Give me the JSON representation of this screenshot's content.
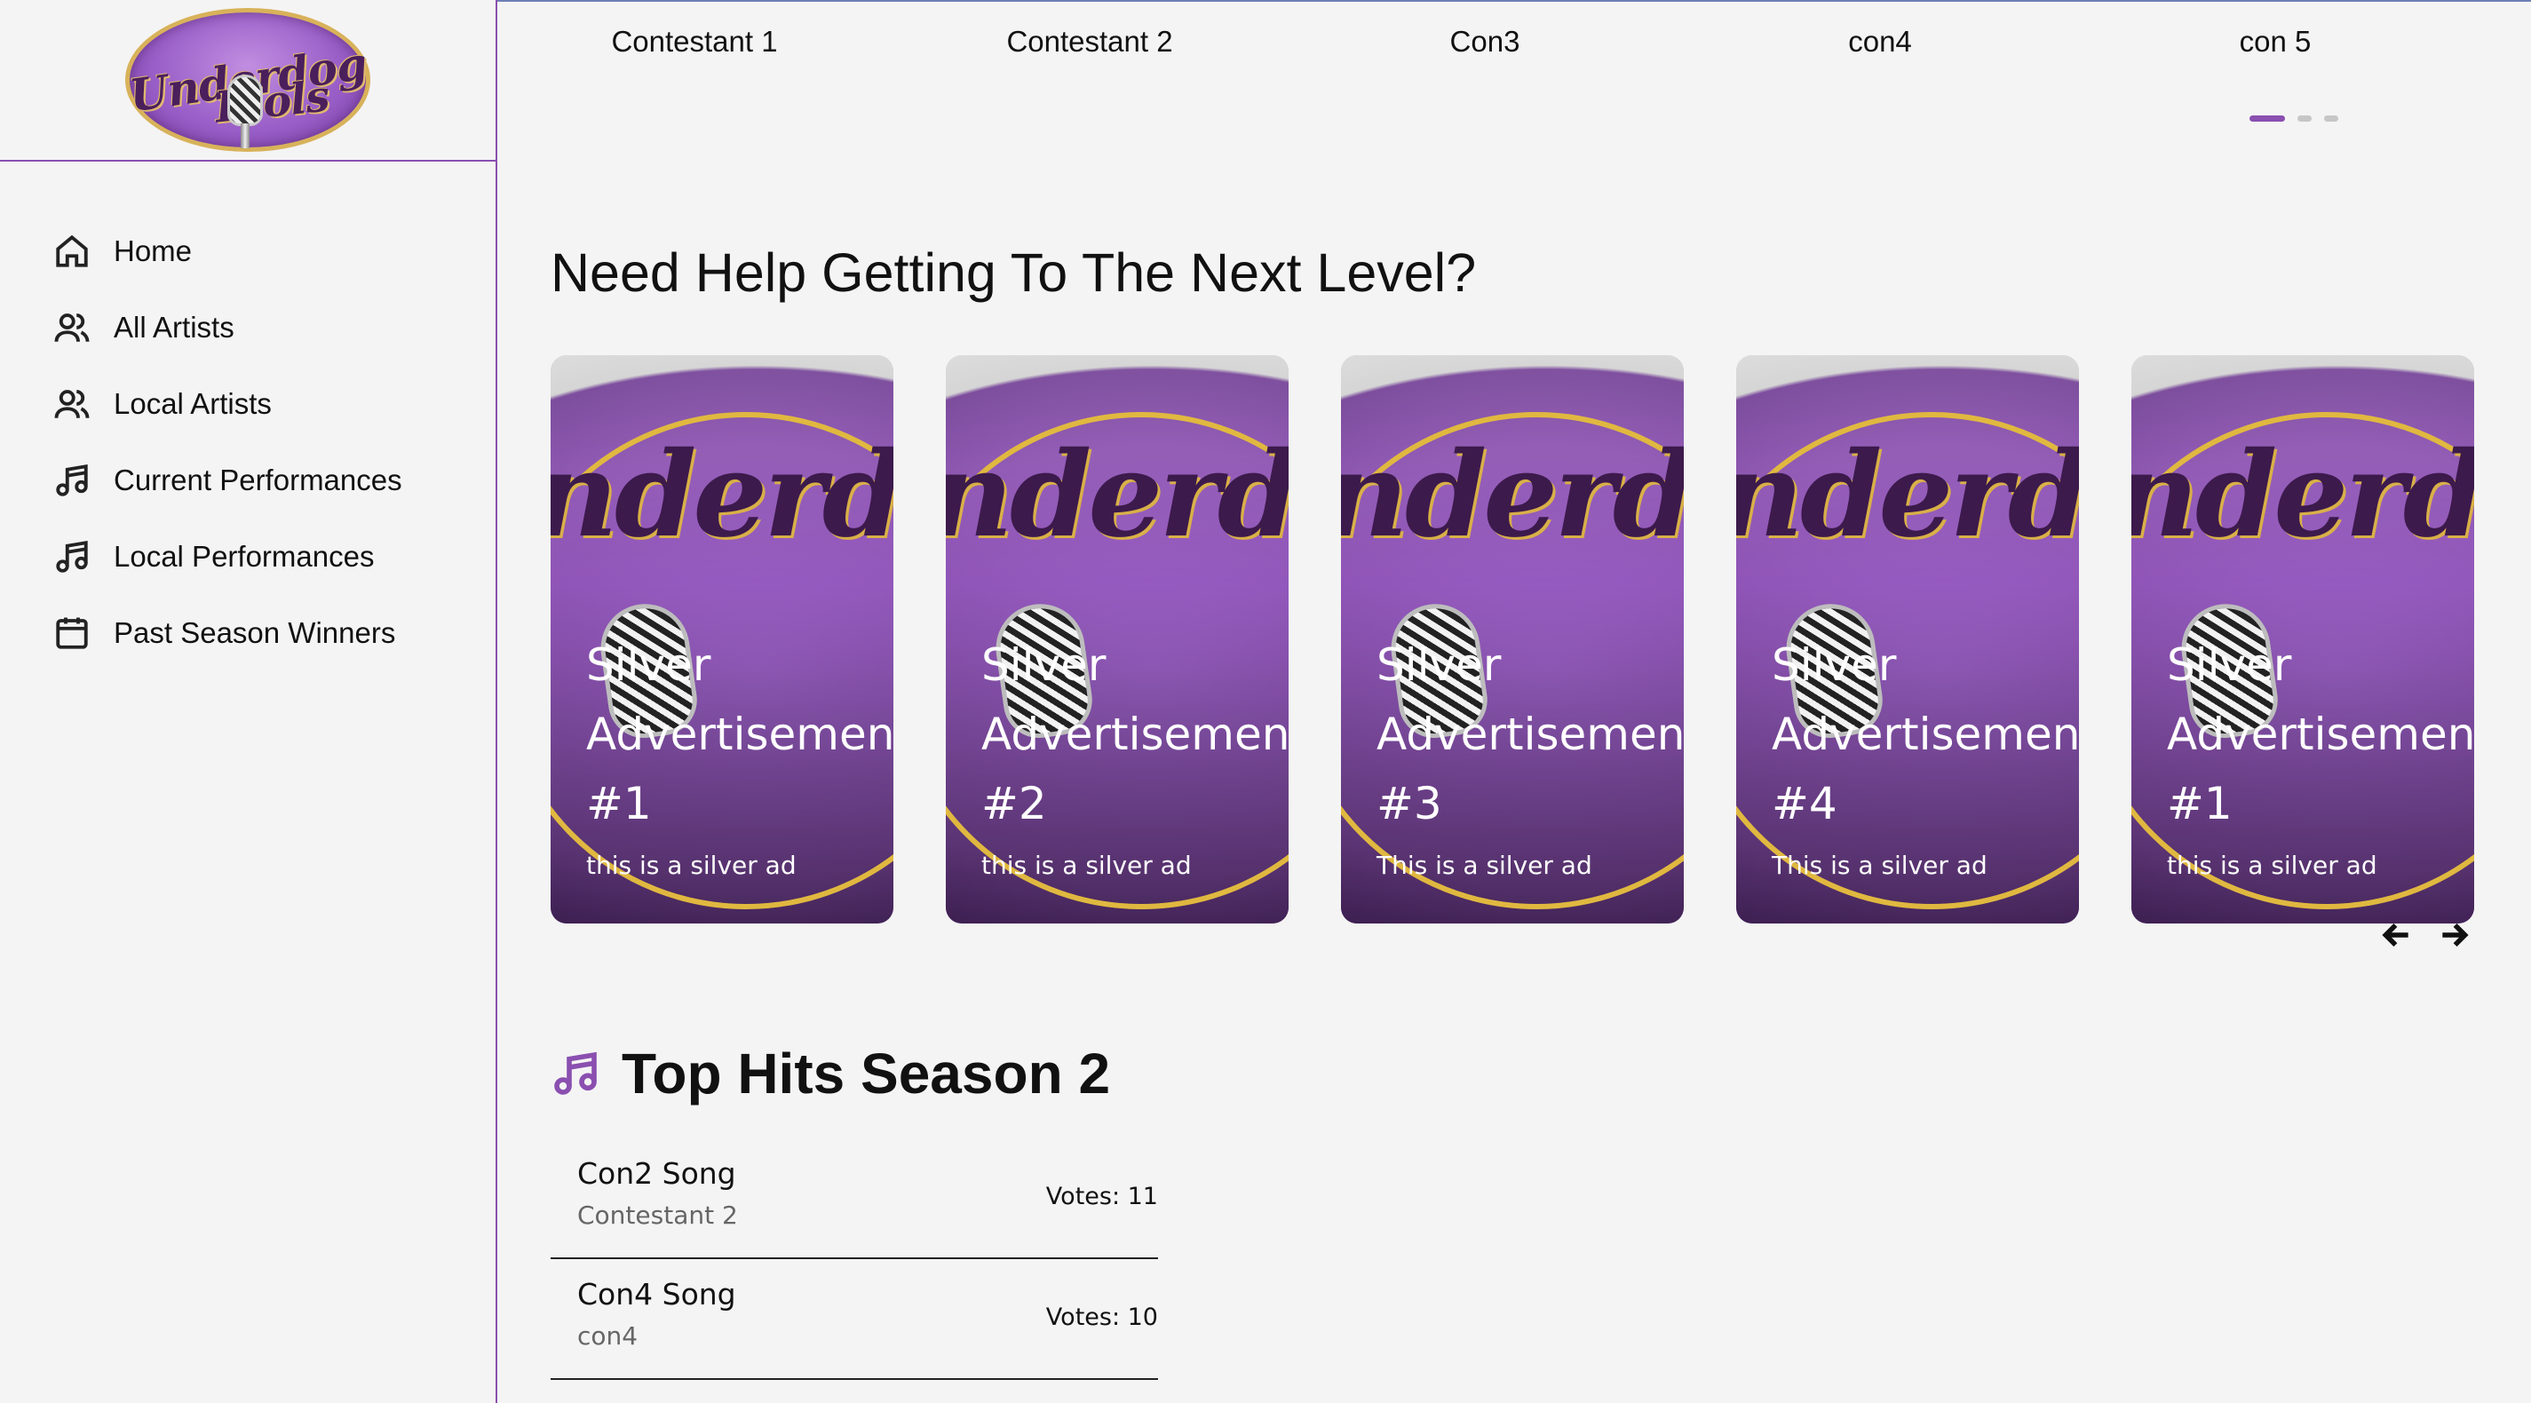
{
  "brand": {
    "logo_top": "Underdog",
    "logo_bottom": "Idols"
  },
  "sidebar": {
    "items": [
      {
        "label": "Home",
        "icon": "home-icon"
      },
      {
        "label": "All Artists",
        "icon": "users-icon"
      },
      {
        "label": "Local Artists",
        "icon": "users-icon"
      },
      {
        "label": "Current Performances",
        "icon": "music-note-icon"
      },
      {
        "label": "Local Performances",
        "icon": "music-note-icon"
      },
      {
        "label": "Past Season Winners",
        "icon": "calendar-icon"
      }
    ]
  },
  "contestants": [
    "Contestant 1",
    "Contestant 2",
    "Con3",
    "con4",
    "con 5"
  ],
  "carousel_pages": {
    "count": 3,
    "active": 1
  },
  "ads_section": {
    "title": "Need Help Getting To The Next Level?",
    "ads": [
      {
        "title_line1": "Silver",
        "title_line2": "Advertisement",
        "title_line3": "#1",
        "subtitle": "this is a silver ad"
      },
      {
        "title_line1": "Silver",
        "title_line2": "Advertisement",
        "title_line3": "#2",
        "subtitle": "this is a silver ad"
      },
      {
        "title_line1": "Silver",
        "title_line2": "Advertisement",
        "title_line3": "#3",
        "subtitle": "This is a silver ad"
      },
      {
        "title_line1": "Silver",
        "title_line2": "Advertisement",
        "title_line3": "#4",
        "subtitle": "This is a silver ad"
      },
      {
        "title_line1": "Silver",
        "title_line2": "Advertisement",
        "title_line3": "#1",
        "subtitle": "this is a silver ad"
      }
    ]
  },
  "top_hits": {
    "title": "Top Hits Season 2",
    "songs": [
      {
        "song": "Con2 Song",
        "artist": "Contestant 2",
        "votes": "Votes: 11"
      },
      {
        "song": "Con4 Song",
        "artist": "con4",
        "votes": "Votes: 10"
      }
    ]
  },
  "colors": {
    "accent": "#8a4fb0",
    "background": "#f4f4f4",
    "divider": "#222222"
  }
}
